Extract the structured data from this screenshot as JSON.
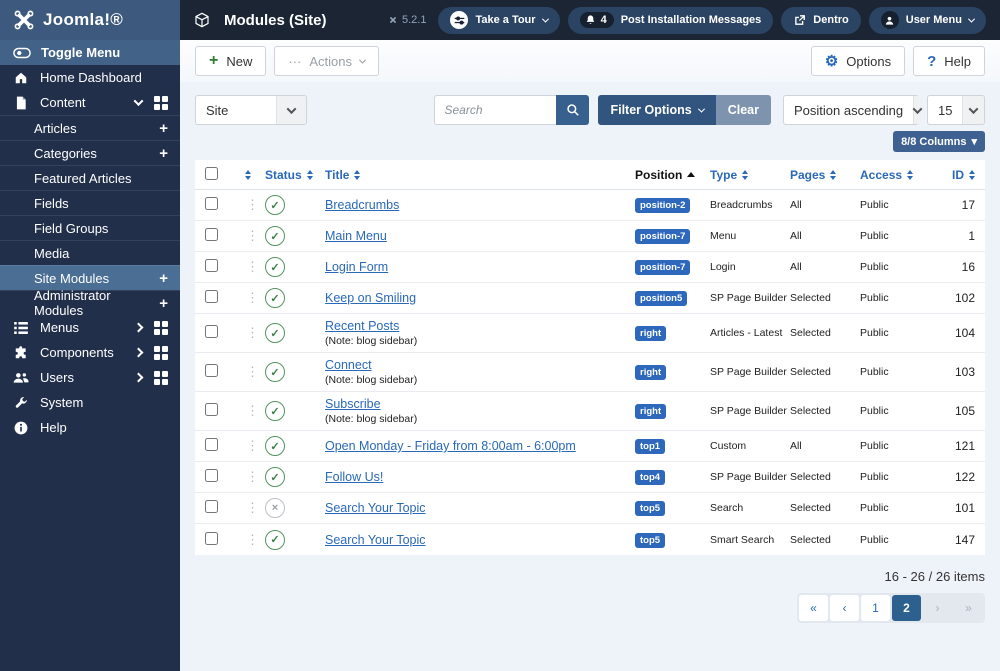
{
  "brand": {
    "logo_text": "Joomla!®",
    "version": "5.2.1"
  },
  "header": {
    "title": "Modules (Site)",
    "take_a_tour": "Take a Tour",
    "messages_count": "4",
    "messages_label": "Post Installation Messages",
    "site_name": "Dentro",
    "user_menu": "User Menu"
  },
  "sidebar": {
    "toggle_label": "Toggle Menu",
    "items": [
      {
        "label": "Home Dashboard"
      },
      {
        "label": "Content"
      },
      {
        "label": "Articles"
      },
      {
        "label": "Categories"
      },
      {
        "label": "Featured Articles"
      },
      {
        "label": "Fields"
      },
      {
        "label": "Field Groups"
      },
      {
        "label": "Media"
      },
      {
        "label": "Site Modules"
      },
      {
        "label": "Administrator Modules"
      },
      {
        "label": "Menus"
      },
      {
        "label": "Components"
      },
      {
        "label": "Users"
      },
      {
        "label": "System"
      },
      {
        "label": "Help"
      }
    ]
  },
  "toolbar": {
    "new_label": "New",
    "actions_label": "Actions",
    "options_label": "Options",
    "help_label": "Help"
  },
  "filterbar": {
    "site_filter": "Site",
    "search_placeholder": "Search",
    "filter_options_label": "Filter Options",
    "clear_label": "Clear",
    "sort_value": "Position ascending",
    "limit_value": "15",
    "columns_label": "8/8 Columns"
  },
  "table": {
    "headers": {
      "status": "Status",
      "title": "Title",
      "position": "Position",
      "type": "Type",
      "pages": "Pages",
      "access": "Access",
      "id": "ID"
    },
    "rows": [
      {
        "status": "published",
        "title": "Breadcrumbs",
        "note": "",
        "position": "position-2",
        "type": "Breadcrumbs",
        "pages": "All",
        "access": "Public",
        "id": "17"
      },
      {
        "status": "published",
        "title": "Main Menu",
        "note": "",
        "position": "position-7",
        "type": "Menu",
        "pages": "All",
        "access": "Public",
        "id": "1"
      },
      {
        "status": "published",
        "title": "Login Form",
        "note": "",
        "position": "position-7",
        "type": "Login",
        "pages": "All",
        "access": "Public",
        "id": "16"
      },
      {
        "status": "published",
        "title": "Keep on Smiling",
        "note": "",
        "position": "position5",
        "type": "SP Page Builder",
        "pages": "Selected",
        "access": "Public",
        "id": "102"
      },
      {
        "status": "published",
        "title": "Recent Posts",
        "note": "(Note: blog sidebar)",
        "position": "right",
        "type": "Articles - Latest",
        "pages": "Selected",
        "access": "Public",
        "id": "104"
      },
      {
        "status": "published",
        "title": "Connect",
        "note": "(Note: blog sidebar)",
        "position": "right",
        "type": "SP Page Builder",
        "pages": "Selected",
        "access": "Public",
        "id": "103"
      },
      {
        "status": "published",
        "title": "Subscribe",
        "note": "(Note: blog sidebar)",
        "position": "right",
        "type": "SP Page Builder",
        "pages": "Selected",
        "access": "Public",
        "id": "105"
      },
      {
        "status": "published",
        "title": "Open Monday - Friday from 8:00am - 6:00pm",
        "note": "",
        "position": "top1",
        "type": "Custom",
        "pages": "All",
        "access": "Public",
        "id": "121"
      },
      {
        "status": "published",
        "title": "Follow Us!",
        "note": "",
        "position": "top4",
        "type": "SP Page Builder",
        "pages": "Selected",
        "access": "Public",
        "id": "122"
      },
      {
        "status": "unpublished",
        "title": "Search Your Topic",
        "note": "",
        "position": "top5",
        "type": "Search",
        "pages": "Selected",
        "access": "Public",
        "id": "101"
      },
      {
        "status": "published",
        "title": "Search Your Topic",
        "note": "",
        "position": "top5",
        "type": "Smart Search",
        "pages": "Selected",
        "access": "Public",
        "id": "147"
      }
    ]
  },
  "footer": {
    "summary": "16 - 26 / 26 items",
    "pagination": {
      "pages": [
        "1",
        "2"
      ],
      "active": "2"
    }
  },
  "icons": {
    "plus": "+",
    "drag_handle": "⋮",
    "check": "✓",
    "cross": "×",
    "gear": "⚙",
    "help_q": "?",
    "ellipsis": "···",
    "caret": "▾",
    "first": "«",
    "prev": "‹",
    "next": "›",
    "last": "»"
  }
}
